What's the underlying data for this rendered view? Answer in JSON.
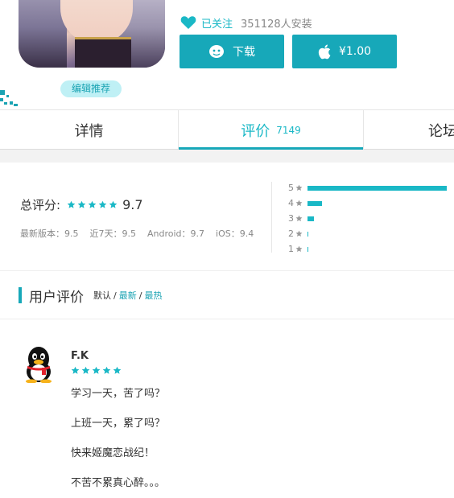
{
  "app": {
    "editor_badge": "编辑推荐",
    "follow_label": "已关注",
    "installs": "351128人安装",
    "download_label": "下载",
    "price_label": "¥1.00"
  },
  "tabs": {
    "detail": "详情",
    "review": "评价",
    "review_count": "7149",
    "forum": "论坛"
  },
  "score": {
    "label": "总评分:",
    "value": "9.7",
    "stars": 5,
    "sub_scores": [
      "最新版本：9.5",
      "近7天：9.5",
      "Android：9.7",
      "iOS：9.4"
    ]
  },
  "distribution": [
    {
      "stars": "5",
      "fraction": 0.95
    },
    {
      "stars": "4",
      "fraction": 0.1
    },
    {
      "stars": "3",
      "fraction": 0.045
    },
    {
      "stars": "2",
      "fraction": 0.008
    },
    {
      "stars": "1",
      "fraction": 0.005
    }
  ],
  "reviews_section": {
    "title": "用户评价",
    "sort_default": "默认",
    "sort_latest": "最新",
    "sort_hot": "最热",
    "separator": "/"
  },
  "reviews": [
    {
      "user": "F.K",
      "rating": 5,
      "lines": [
        "学习一天，苦了吗？",
        "上班一天，累了吗？",
        "快来姬魔恋战纪！",
        "不苦不累真心醉。。。"
      ]
    }
  ],
  "colors": {
    "accent": "#17a8b9",
    "accent_text": "#1ab8c6",
    "badge_bg": "#bff0f5"
  },
  "icons": {
    "follow": "heart-icon",
    "download": "android-robot-icon",
    "buy": "apple-icon",
    "rating": "star-icon",
    "avatar": "qq-penguin-icon"
  }
}
